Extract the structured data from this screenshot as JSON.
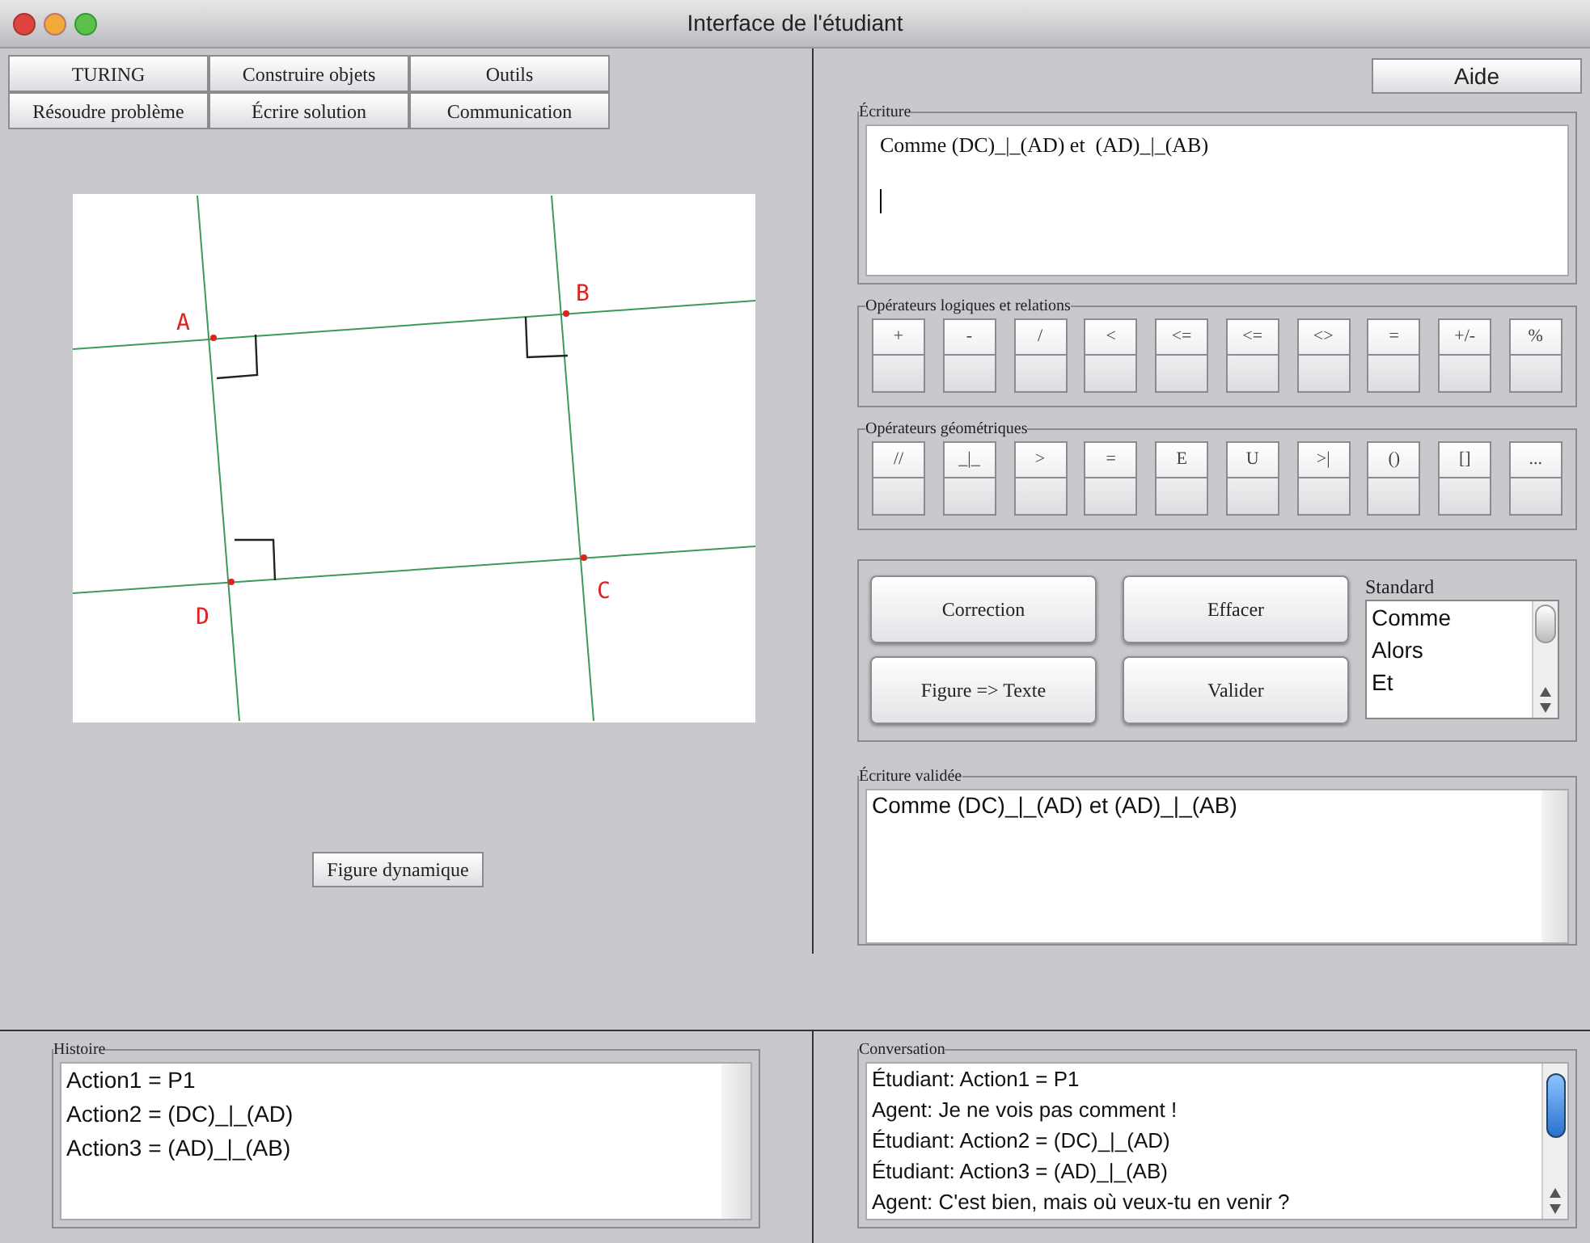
{
  "window": {
    "title": "Interface de l'étudiant"
  },
  "menu_buttons": [
    [
      "TURING",
      "Construire objets",
      "Outils"
    ],
    [
      "Résoudre problème",
      "Écrire solution",
      "Communication"
    ]
  ],
  "help_button": "Aide",
  "figure": {
    "points": [
      {
        "label": "A"
      },
      {
        "label": "B"
      },
      {
        "label": "C"
      },
      {
        "label": "D"
      }
    ],
    "button": "Figure dynamique"
  },
  "ecriture": {
    "legend": "Écriture",
    "value": "Comme (DC)_|_(AD) et  (AD)_|_(AB)"
  },
  "logic_operators": {
    "legend": "Opérateurs logiques et relations",
    "keys": [
      "+",
      "-",
      "/",
      "<",
      "<=",
      "<=",
      "<>",
      "=",
      "+/-",
      "%"
    ]
  },
  "geometric_operators": {
    "legend": "Opérateurs géométriques",
    "keys": [
      "//",
      "_|_",
      ">",
      "=",
      "E",
      "U",
      ">|",
      "()",
      "[]",
      "..."
    ]
  },
  "actions": [
    "Correction",
    "Effacer",
    "Figure => Texte",
    "Valider"
  ],
  "standard": {
    "label": "Standard",
    "items": [
      "Comme",
      "Alors",
      "Et"
    ]
  },
  "ecriture_validee": {
    "legend": "Écriture validée",
    "value": "Comme (DC)_|_(AD) et (AD)_|_(AB)"
  },
  "histoire": {
    "legend": "Histoire",
    "lines": [
      "Action1 = P1",
      "Action2 = (DC)_|_(AD)",
      "Action3 = (AD)_|_(AB)"
    ]
  },
  "conversation": {
    "legend": "Conversation",
    "lines": [
      "Étudiant: Action1 = P1",
      "Agent: Je ne vois pas comment !",
      "Étudiant: Action2 = (DC)_|_(AD)",
      "Étudiant: Action3 = (AD)_|_(AB)",
      "Agent: C'est bien, mais où veux-tu en venir ?"
    ]
  }
}
